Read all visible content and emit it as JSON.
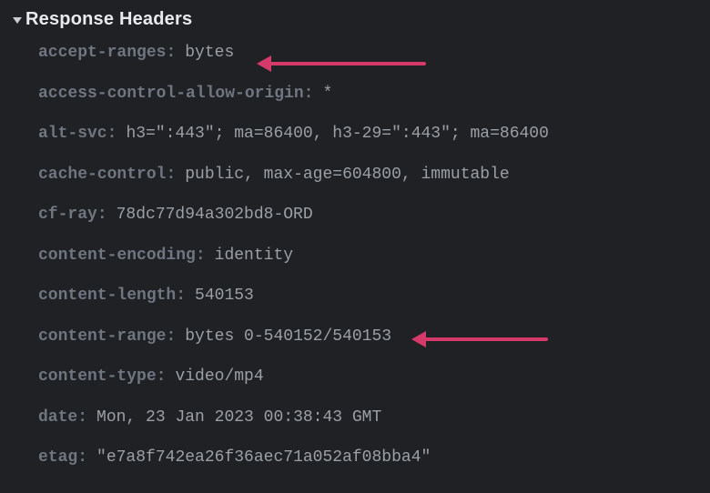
{
  "section": {
    "title": "Response Headers"
  },
  "headers": [
    {
      "name": "accept-ranges",
      "value": "bytes"
    },
    {
      "name": "access-control-allow-origin",
      "value": "*"
    },
    {
      "name": "alt-svc",
      "value": "h3=\":443\"; ma=86400, h3-29=\":443\"; ma=86400"
    },
    {
      "name": "cache-control",
      "value": "public, max-age=604800, immutable"
    },
    {
      "name": "cf-ray",
      "value": "78dc77d94a302bd8-ORD"
    },
    {
      "name": "content-encoding",
      "value": "identity"
    },
    {
      "name": "content-length",
      "value": "540153"
    },
    {
      "name": "content-range",
      "value": "bytes 0-540152/540153"
    },
    {
      "name": "content-type",
      "value": "video/mp4"
    },
    {
      "name": "date",
      "value": "Mon, 23 Jan 2023 00:38:43 GMT"
    },
    {
      "name": "etag",
      "value": "\"e7a8f742ea26f36aec71a052af08bba4\""
    }
  ],
  "annotations": {
    "arrow_color": "#d53a6a",
    "targets": [
      "accept-ranges",
      "content-range"
    ]
  }
}
